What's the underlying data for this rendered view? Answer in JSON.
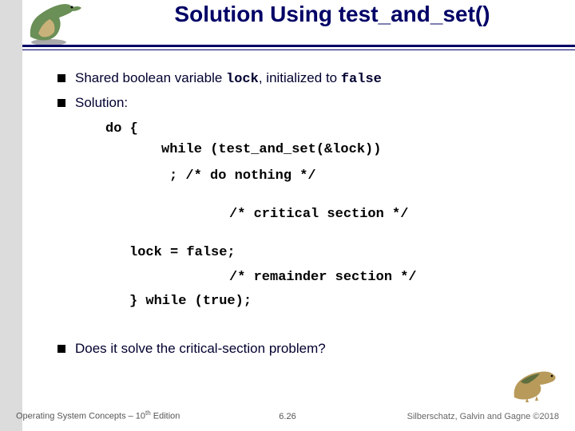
{
  "title": "Solution Using test_and_set()",
  "bullets": {
    "b1_pre": "Shared boolean variable ",
    "b1_code1": "lock",
    "b1_mid": ", initialized to ",
    "b1_code2": "false",
    "b2": "Solution:",
    "b3": "Does it solve the critical-section problem?"
  },
  "code": {
    "l1": "do {",
    "l2": "while (test_and_set(&lock))",
    "l3": "; /* do nothing */",
    "l4": "/* critical section */",
    "l5": "lock = false;",
    "l6": "/* remainder section */",
    "l7": "} while (true);"
  },
  "footer": {
    "left_a": "Operating System Concepts – 10",
    "left_sup": "th",
    "left_b": " Edition",
    "mid": "6.26",
    "right": "Silberschatz, Galvin and Gagne ©2018"
  },
  "logo_colors": {
    "body": "#6a8f57",
    "belly": "#c9b27a",
    "shadow": "#a9a9a9"
  },
  "dino2_colors": {
    "body": "#b89a5a",
    "stripe": "#5e6e3e"
  }
}
